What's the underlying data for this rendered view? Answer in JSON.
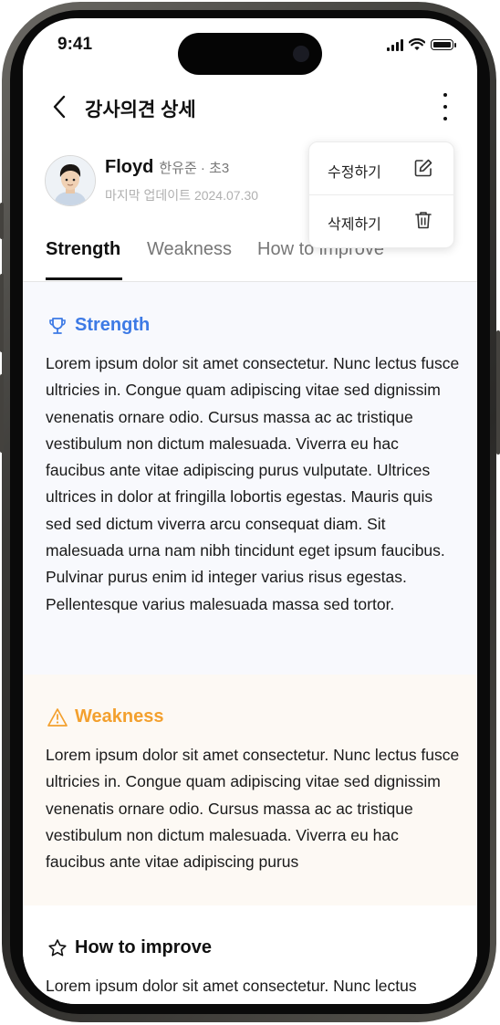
{
  "status_bar": {
    "time": "9:41"
  },
  "header": {
    "title": "강사의견 상세"
  },
  "profile": {
    "name": "Floyd",
    "sub": "한유준 · 초3",
    "updated_label": "마지막 업데이트",
    "updated_date": "2024.07.30"
  },
  "tabs": [
    {
      "label": "Strength",
      "active": true
    },
    {
      "label": "Weakness",
      "active": false
    },
    {
      "label": "How to improve",
      "active": false
    }
  ],
  "menu": {
    "edit_label": "수정하기",
    "delete_label": "삭제하기"
  },
  "sections": {
    "strength": {
      "title": "Strength",
      "color": "#3d7ae5",
      "icon": "trophy-icon",
      "text": "Lorem ipsum dolor sit amet consectetur. Nunc lectus fusce ultricies in. Congue quam adipiscing vitae sed dignissim venenatis ornare odio. Cursus massa ac ac tristique vestibulum non dictum malesuada. Viverra eu hac faucibus ante vitae adipiscing purus vulputate. Ultrices ultrices in dolor at fringilla lobortis egestas. Mauris quis sed sed dictum viverra arcu consequat diam. Sit malesuada urna nam nibh tincidunt eget ipsum faucibus. Pulvinar purus enim id integer varius risus egestas. Pellentesque varius malesuada massa sed tortor."
    },
    "weakness": {
      "title": "Weakness",
      "color": "#f3a02e",
      "icon": "warning-icon",
      "text": "Lorem ipsum dolor sit amet consectetur. Nunc lectus fusce ultricies in. Congue quam adipiscing vitae sed dignissim venenatis ornare odio. Cursus massa ac ac tristique vestibulum non dictum malesuada. Viverra eu hac faucibus ante vitae adipiscing purus"
    },
    "improve": {
      "title": "How to improve",
      "color": "#111111",
      "icon": "star-icon",
      "text": "Lorem ipsum dolor sit amet consectetur. Nunc lectus"
    }
  }
}
